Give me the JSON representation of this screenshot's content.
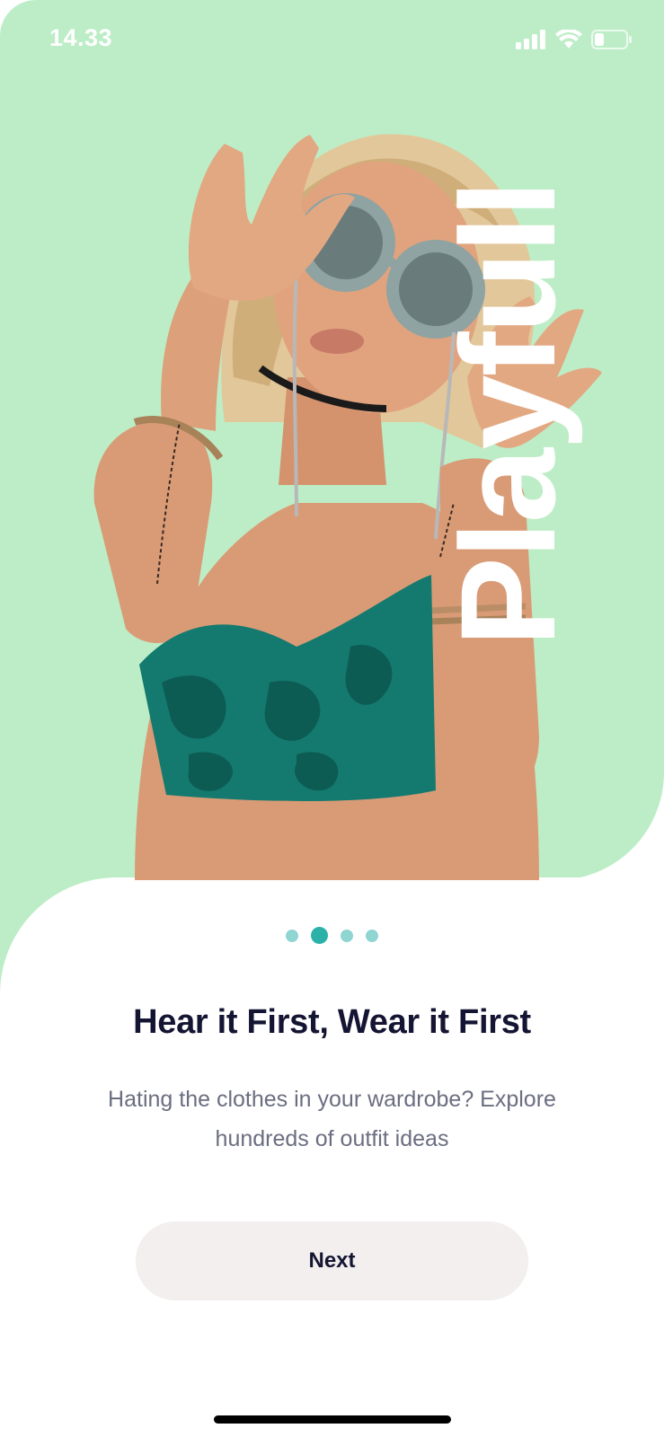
{
  "status_bar": {
    "time": "14.33",
    "icons": [
      "signal-icon",
      "wifi-icon",
      "battery-icon"
    ]
  },
  "hero": {
    "background_color": "#bdedc6",
    "vertical_title": "Playfull",
    "image_subject": "woman-with-sunglasses"
  },
  "pagination": {
    "total": 4,
    "active_index": 1,
    "active_color": "#2bb1a8",
    "inactive_color": "#8fd5d1"
  },
  "content": {
    "headline": "Hear it First, Wear it First",
    "subtext": "Hating the clothes in your wardrobe? Explore hundreds of outfit ideas"
  },
  "actions": {
    "next_label": "Next"
  }
}
